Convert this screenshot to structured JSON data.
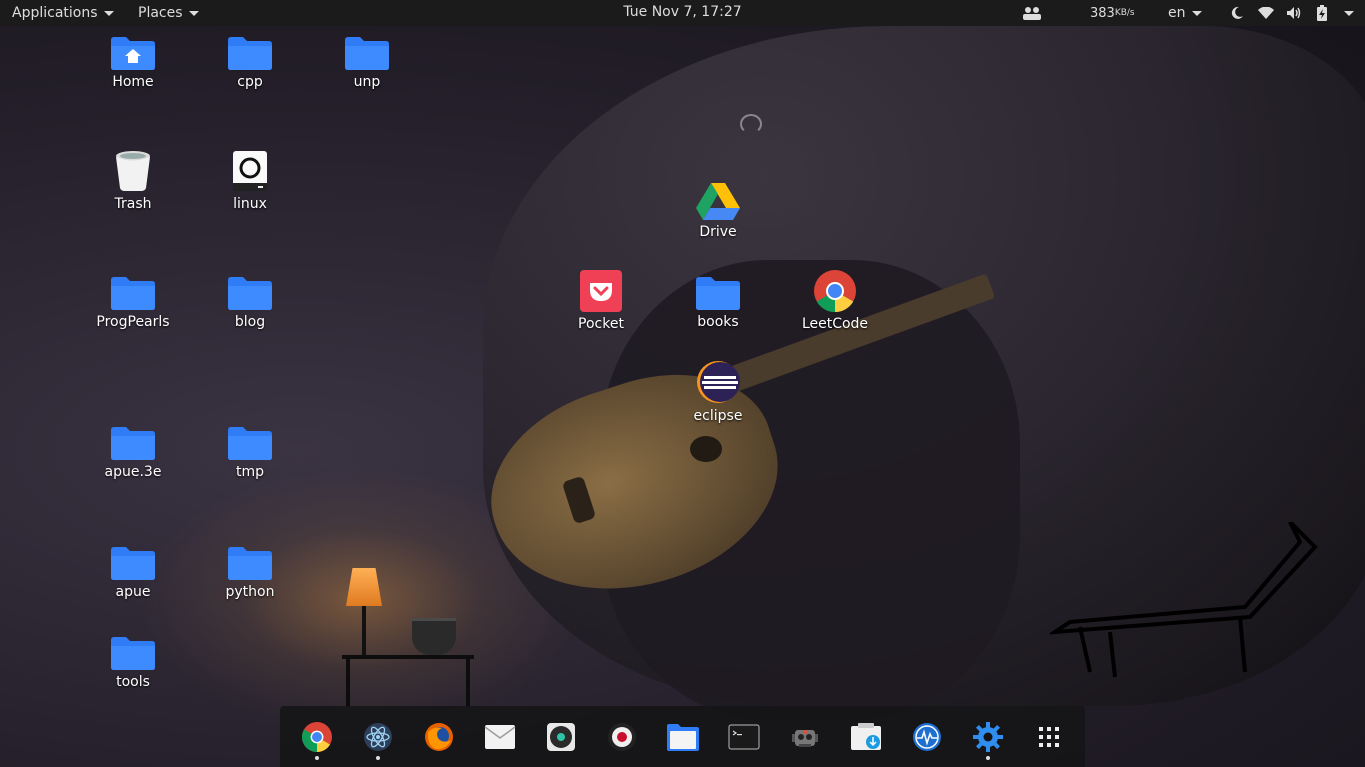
{
  "topbar": {
    "applications_label": "Applications",
    "places_label": "Places",
    "clock": "Tue Nov  7, 17:27",
    "net_speed": "383",
    "net_unit": "KB/s",
    "keyboard_layout": "en"
  },
  "desktop_icons": {
    "home": "Home",
    "cpp": "cpp",
    "unp": "unp",
    "trash": "Trash",
    "linux": "linux",
    "drive": "Drive",
    "progpearls": "ProgPearls",
    "blog": "blog",
    "pocket": "Pocket",
    "books": "books",
    "leetcode": "LeetCode",
    "eclipse": "eclipse",
    "apue3e": "apue.3e",
    "tmp": "tmp",
    "apue": "apue",
    "python": "python",
    "tools": "tools"
  },
  "dock": {
    "items": [
      {
        "icon": "chrome-icon",
        "running": true
      },
      {
        "icon": "atom-icon",
        "running": true
      },
      {
        "icon": "firefox-icon",
        "running": false
      },
      {
        "icon": "mail-icon",
        "running": false
      },
      {
        "icon": "music-player-icon",
        "running": false
      },
      {
        "icon": "screen-recorder-icon",
        "running": false
      },
      {
        "icon": "files-icon",
        "running": false
      },
      {
        "icon": "terminal-icon",
        "running": false
      },
      {
        "icon": "robot-icon",
        "running": false
      },
      {
        "icon": "downloads-icon",
        "running": false
      },
      {
        "icon": "system-monitor-icon",
        "running": false
      },
      {
        "icon": "settings-gear-icon",
        "running": true
      },
      {
        "icon": "app-grid-icon",
        "running": false
      }
    ]
  },
  "colors": {
    "folder_blue": "#2f7cf6",
    "topbar_bg": "#1b1b1b"
  }
}
